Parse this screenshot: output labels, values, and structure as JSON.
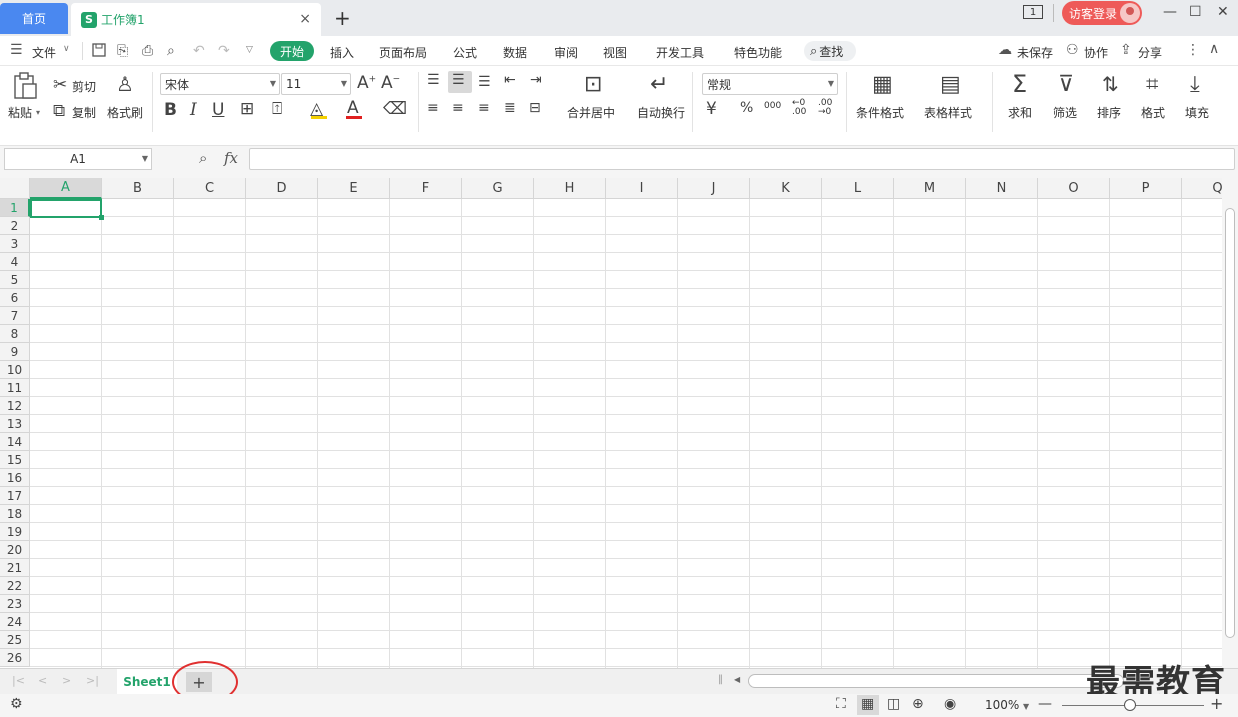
{
  "titlebar": {
    "home_tab": "首页",
    "doc_icon": "S",
    "doc_title": "工作簿1",
    "close_glyph": "×",
    "new_tab_glyph": "+",
    "page_badge": "1",
    "login_label": "访客登录",
    "minimize_glyph": "—",
    "maximize_glyph": "☐",
    "close_window_glyph": "✕"
  },
  "menubar": {
    "file_label": "文件",
    "tabs": [
      "开始",
      "插入",
      "页面布局",
      "公式",
      "数据",
      "审阅",
      "视图",
      "开发工具",
      "特色功能"
    ],
    "search_label": "查找",
    "unsaved_label": "未保存",
    "collab_label": "协作",
    "share_label": "分享"
  },
  "ribbon": {
    "paste": "粘贴",
    "cut": "剪切",
    "copy": "复制",
    "format_painter": "格式刷",
    "font_name": "宋体",
    "font_size": "11",
    "merge_center": "合并居中",
    "wrap_text": "自动换行",
    "number_format": "常规",
    "cond_format": "条件格式",
    "table_style": "表格样式",
    "sum": "求和",
    "filter": "筛选",
    "sort": "排序",
    "format": "格式",
    "fill": "填充",
    "currency_glyph": "¥",
    "percent_glyph": "%",
    "thousands_glyph": "000"
  },
  "formula_bar": {
    "name_box": "A1",
    "fx_label": "fx",
    "formula_value": ""
  },
  "grid": {
    "columns": [
      "A",
      "B",
      "C",
      "D",
      "E",
      "F",
      "G",
      "H",
      "I",
      "J",
      "K",
      "L",
      "M",
      "N",
      "O",
      "P",
      "Q"
    ],
    "rows": [
      "1",
      "2",
      "3",
      "4",
      "5",
      "6",
      "7",
      "8",
      "9",
      "10",
      "11",
      "12",
      "13",
      "14",
      "15",
      "16",
      "17",
      "18",
      "19",
      "20",
      "21",
      "22",
      "23",
      "24",
      "25",
      "26"
    ],
    "selected_column": "A",
    "selected_row": "1"
  },
  "sheets": {
    "tabs": [
      "Sheet1"
    ],
    "add_glyph": "+"
  },
  "watermark": "最需教育",
  "statusbar": {
    "zoom": "100%",
    "zoom_out": "—",
    "zoom_in": "+"
  },
  "colors": {
    "accent": "#23a36b",
    "home_tab": "#4a88f0",
    "login": "#ee5a58",
    "highlight_circle": "#e03030"
  }
}
